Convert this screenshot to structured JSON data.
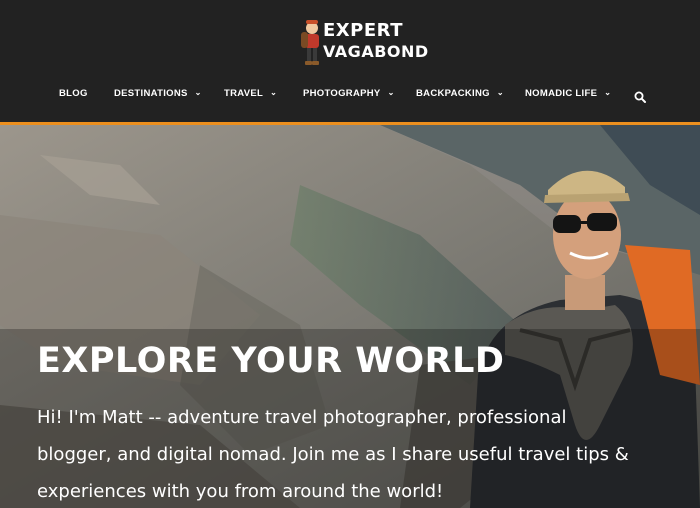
{
  "site": {
    "logo_line1": "EXPERT",
    "logo_line2": "VAGABOND"
  },
  "nav": {
    "items": [
      {
        "label": "BLOG",
        "dropdown": false
      },
      {
        "label": "DESTINATIONS",
        "dropdown": true
      },
      {
        "label": "TRAVEL",
        "dropdown": true
      },
      {
        "label": "PHOTOGRAPHY",
        "dropdown": true
      },
      {
        "label": "BACKPACKING",
        "dropdown": true
      },
      {
        "label": "NOMADIC LIFE",
        "dropdown": true
      }
    ],
    "chevron": "⌄",
    "search_icon": "search-icon"
  },
  "hero": {
    "title": "EXPLORE YOUR WORLD",
    "text": "Hi! I'm Matt -- adventure travel photographer, professional blogger, and digital nomad. Join me as I share useful travel tips & experiences with you from around the world!"
  },
  "colors": {
    "header_bg": "#222222",
    "accent": "#ec8f1e",
    "nav_text": "#ffffff"
  }
}
